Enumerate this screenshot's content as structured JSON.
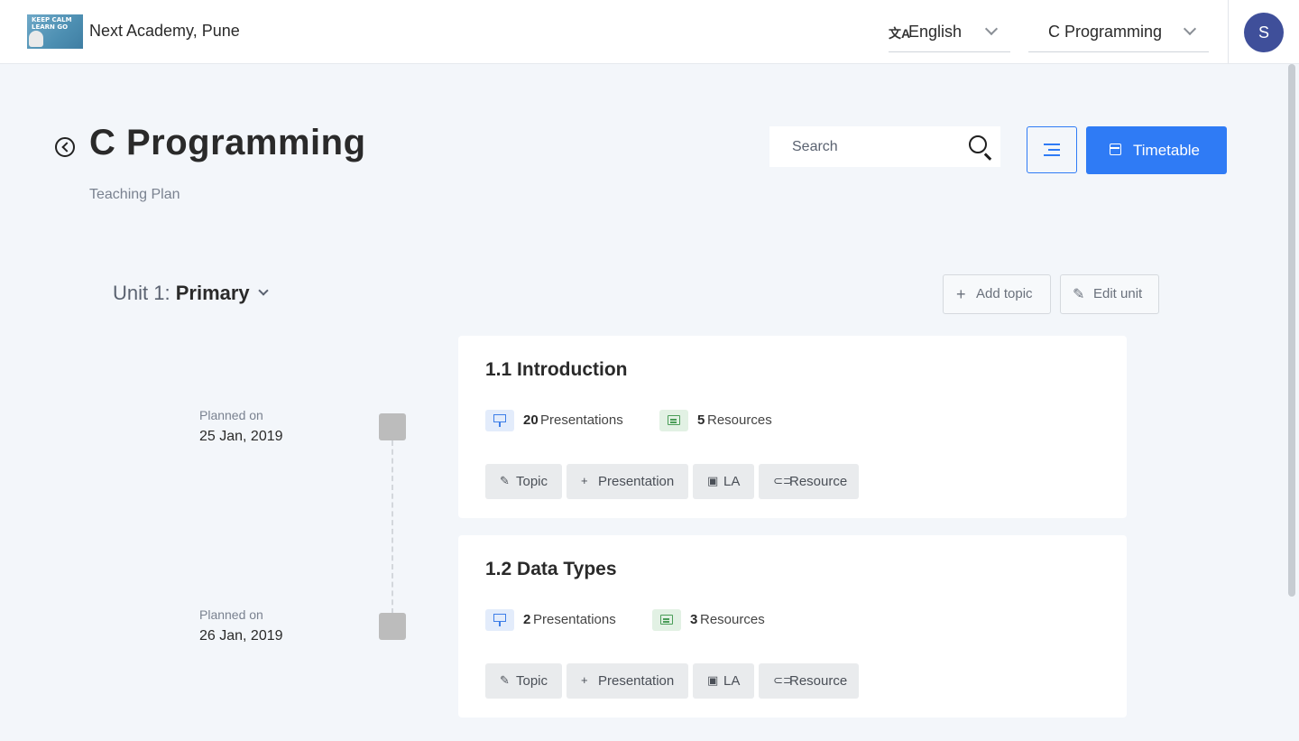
{
  "header": {
    "school_name": "Next Academy, Pune",
    "logo_text": "KEEP CALM LEARN GO",
    "language": "English",
    "course": "C Programming",
    "avatar_initial": "S"
  },
  "page": {
    "title": "C Programming",
    "subtitle": "Teaching Plan",
    "search_placeholder": "Search",
    "timetable_label": "Timetable"
  },
  "unit": {
    "prefix": "Unit 1:",
    "name": "Primary",
    "add_topic_label": "Add topic",
    "edit_unit_label": "Edit unit"
  },
  "topics": [
    {
      "title": "1.1 Introduction",
      "planned_label": "Planned on",
      "planned_date": "25 Jan, 2019",
      "presentations_count": "20",
      "presentations_label": "Presentations",
      "resources_count": "5",
      "resources_label": "Resources"
    },
    {
      "title": "1.2 Data Types",
      "planned_label": "Planned on",
      "planned_date": "26 Jan, 2019",
      "presentations_count": "2",
      "presentations_label": "Presentations",
      "resources_count": "3",
      "resources_label": "Resources"
    }
  ],
  "actions": {
    "topic": "Topic",
    "presentation": "Presentation",
    "la": "LA",
    "resource": "Resource"
  },
  "colors": {
    "primary": "#2f7bf5",
    "avatar": "#3f4f9a",
    "background": "#f3f6fa",
    "timeline_node": "#bcbcbc"
  }
}
